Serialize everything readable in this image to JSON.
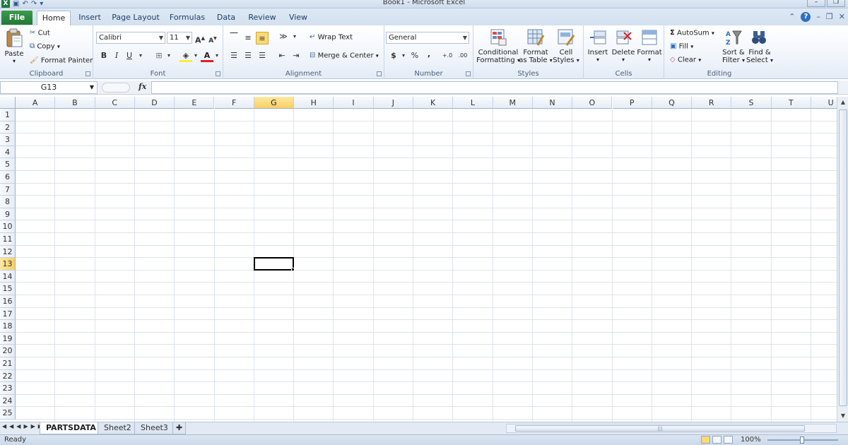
{
  "window": {
    "title": "Book1  -  Microsoft Excel"
  },
  "tabs": {
    "file": "File",
    "items": [
      "Home",
      "Insert",
      "Page Layout",
      "Formulas",
      "Data",
      "Review",
      "View"
    ],
    "active": "Home"
  },
  "clipboard": {
    "label": "Clipboard",
    "paste": "Paste",
    "cut": "Cut",
    "copy": "Copy",
    "format_painter": "Format Painter"
  },
  "font": {
    "label": "Font",
    "name": "Calibri",
    "size": "11",
    "bold": "B",
    "italic": "I",
    "underline": "U",
    "grow": "A",
    "shrink": "A",
    "color_letter": "A"
  },
  "alignment": {
    "label": "Alignment",
    "wrap": "Wrap Text",
    "merge": "Merge & Center"
  },
  "number": {
    "label": "Number",
    "format": "General",
    "currency": "$",
    "percent": "%",
    "comma": ",",
    "inc": "+.0",
    "dec": ".00"
  },
  "styles": {
    "label": "Styles",
    "conditional_1": "Conditional",
    "conditional_2": "Formatting",
    "format_table_1": "Format",
    "format_table_2": "as Table",
    "cell_styles_1": "Cell",
    "cell_styles_2": "Styles"
  },
  "cells": {
    "label": "Cells",
    "insert": "Insert",
    "delete": "Delete",
    "format": "Format"
  },
  "editing": {
    "label": "Editing",
    "autosum": "AutoSum",
    "fill": "Fill",
    "clear": "Clear",
    "sort_1": "Sort &",
    "sort_2": "Filter",
    "find_1": "Find &",
    "find_2": "Select"
  },
  "formula_bar": {
    "name_box": "G13",
    "fx": "fx",
    "value": ""
  },
  "grid": {
    "columns": [
      "A",
      "B",
      "C",
      "D",
      "E",
      "F",
      "G",
      "H",
      "I",
      "J",
      "K",
      "L",
      "M",
      "N",
      "O",
      "P",
      "Q",
      "R",
      "S",
      "T",
      "U"
    ],
    "rows": [
      "1",
      "2",
      "3",
      "4",
      "5",
      "6",
      "7",
      "8",
      "9",
      "10",
      "11",
      "12",
      "13",
      "14",
      "15",
      "16",
      "17",
      "18",
      "19",
      "20",
      "21",
      "22",
      "23",
      "24",
      "25"
    ],
    "selected_column": "G",
    "selected_row": "13"
  },
  "sheets": {
    "items": [
      "PARTSDATA",
      "Sheet2",
      "Sheet3"
    ],
    "active": "PARTSDATA"
  },
  "status": {
    "ready": "Ready",
    "zoom": "100%"
  },
  "colors": {
    "accent": "#217a34",
    "selection": "#f8cf63"
  }
}
